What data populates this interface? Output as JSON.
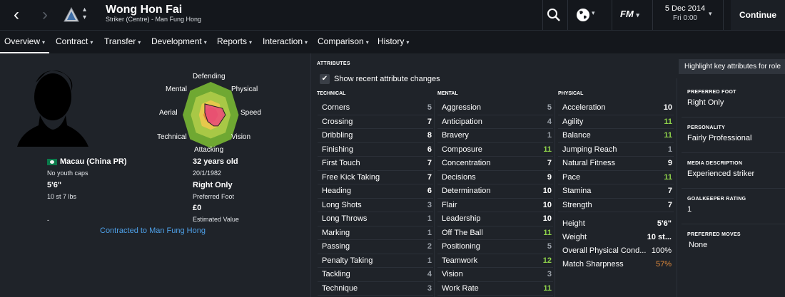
{
  "colors": {
    "bg": "#1f2329",
    "bar": "#14171c",
    "green": "#8ed14a",
    "grey": "#9aa0a8",
    "orange": "#e08a3c",
    "link": "#4ea0e8"
  },
  "header": {
    "name": "Wong Hon Fai",
    "sub": "Striker (Centre) - Man Fung Hong",
    "back_icon": "chevron-left-icon",
    "forward_icon": "chevron-right-icon",
    "club_icon": "club-crest-icon",
    "search_icon": "search-icon",
    "globe_icon": "globe-icon",
    "fm_label": "FM",
    "date": "5 Dec 2014",
    "time": "Fri 0:00",
    "continue": "Continue"
  },
  "tabs": [
    "Overview",
    "Contract",
    "Transfer",
    "Development",
    "Reports",
    "Interaction",
    "Comparison",
    "History"
  ],
  "radar": {
    "labels": [
      "Defending",
      "Physical",
      "Speed",
      "Vision",
      "Attacking",
      "Technical",
      "Aerial",
      "Mental"
    ]
  },
  "profile": {
    "nationality": "Macau (China PR)",
    "caps": "No youth caps",
    "height": "5'6\"",
    "weight": "10 st 7 lbs",
    "dash": "-",
    "age": "32 years old",
    "dob": "20/1/1982",
    "foot": "Right Only",
    "foot_label": "Preferred Foot",
    "value": "£0",
    "value_label": "Estimated Value",
    "contract": "Contracted to Man Fung Hong"
  },
  "attributes": {
    "title": "ATTRIBUTES",
    "show_changes": "Show recent attribute changes",
    "highlight_button": "Highlight key attributes for role",
    "technical_title": "TECHNICAL",
    "mental_title": "MENTAL",
    "physical_title": "PHYSICAL",
    "technical": [
      {
        "name": "Corners",
        "value": "5"
      },
      {
        "name": "Crossing",
        "value": "7"
      },
      {
        "name": "Dribbling",
        "value": "8"
      },
      {
        "name": "Finishing",
        "value": "6"
      },
      {
        "name": "First Touch",
        "value": "7"
      },
      {
        "name": "Free Kick Taking",
        "value": "7"
      },
      {
        "name": "Heading",
        "value": "6"
      },
      {
        "name": "Long Shots",
        "value": "3"
      },
      {
        "name": "Long Throws",
        "value": "1"
      },
      {
        "name": "Marking",
        "value": "1"
      },
      {
        "name": "Passing",
        "value": "2"
      },
      {
        "name": "Penalty Taking",
        "value": "1"
      },
      {
        "name": "Tackling",
        "value": "4"
      },
      {
        "name": "Technique",
        "value": "3"
      }
    ],
    "mental": [
      {
        "name": "Aggression",
        "value": "5"
      },
      {
        "name": "Anticipation",
        "value": "4"
      },
      {
        "name": "Bravery",
        "value": "1"
      },
      {
        "name": "Composure",
        "value": "11"
      },
      {
        "name": "Concentration",
        "value": "7"
      },
      {
        "name": "Decisions",
        "value": "9"
      },
      {
        "name": "Determination",
        "value": "10"
      },
      {
        "name": "Flair",
        "value": "10"
      },
      {
        "name": "Leadership",
        "value": "10"
      },
      {
        "name": "Off The Ball",
        "value": "11"
      },
      {
        "name": "Positioning",
        "value": "5"
      },
      {
        "name": "Teamwork",
        "value": "12"
      },
      {
        "name": "Vision",
        "value": "3"
      },
      {
        "name": "Work Rate",
        "value": "11"
      }
    ],
    "physical": [
      {
        "name": "Acceleration",
        "value": "10"
      },
      {
        "name": "Agility",
        "value": "11"
      },
      {
        "name": "Balance",
        "value": "11"
      },
      {
        "name": "Jumping Reach",
        "value": "1"
      },
      {
        "name": "Natural Fitness",
        "value": "9"
      },
      {
        "name": "Pace",
        "value": "11"
      },
      {
        "name": "Stamina",
        "value": "7"
      },
      {
        "name": "Strength",
        "value": "7"
      }
    ],
    "misc": [
      {
        "name": "Height",
        "value": "5'6\""
      },
      {
        "name": "Weight",
        "value": "10 st..."
      },
      {
        "name": "Overall Physical Cond...",
        "value": "100%"
      },
      {
        "name": "Match Sharpness",
        "value": "57%"
      }
    ]
  },
  "side": {
    "pf_title": "PREFERRED FOOT",
    "pf": "Right Only",
    "pers_title": "PERSONALITY",
    "pers": "Fairly Professional",
    "media_title": "MEDIA DESCRIPTION",
    "media": "Experienced striker",
    "gk_title": "GOALKEEPER RATING",
    "gk": "1",
    "moves_title": "PREFERRED MOVES",
    "moves": "None"
  }
}
